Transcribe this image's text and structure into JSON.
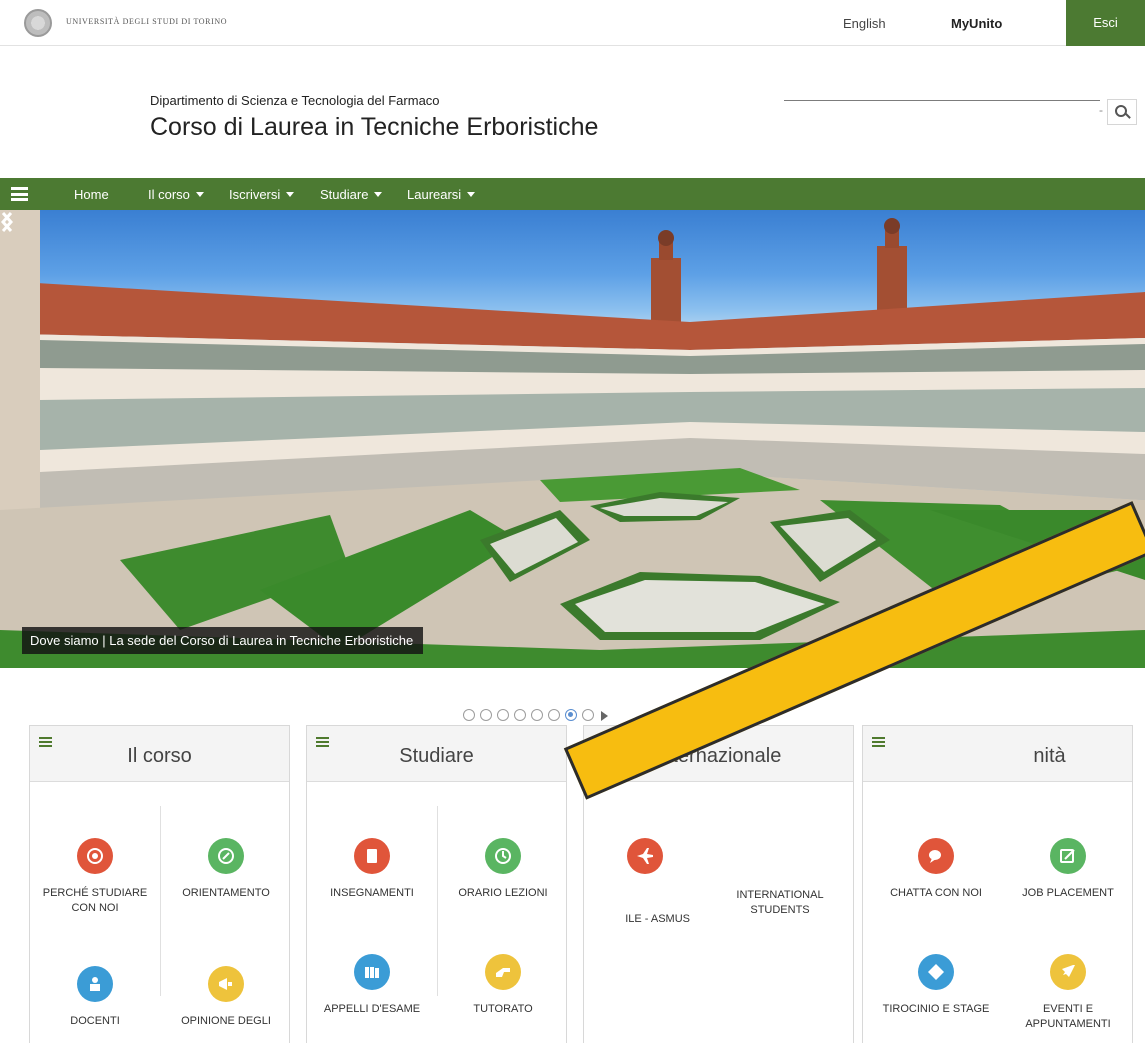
{
  "topbar": {
    "university": "Università degli Studi di Torino",
    "english": "English",
    "myunito": "MyUnito",
    "esci": "Esci"
  },
  "header": {
    "department": "Dipartimento di Scienza e Tecnologia del Farmaco",
    "course_title": "Corso di Laurea in Tecniche Erboristiche",
    "search_separator": "-",
    "search_icon": "search-icon"
  },
  "nav": {
    "items": [
      {
        "label": "Home",
        "dropdown": false
      },
      {
        "label": "Il corso",
        "dropdown": true
      },
      {
        "label": "Iscriversi",
        "dropdown": true
      },
      {
        "label": "Studiare",
        "dropdown": true
      },
      {
        "label": "Laurearsi",
        "dropdown": true
      }
    ]
  },
  "hero": {
    "caption": "Dove siamo | La sede del Corso di Laurea in Tecniche Erboristiche",
    "slides_total": 8,
    "active_slide": 7
  },
  "cards": [
    {
      "title": "Il corso",
      "tiles": [
        {
          "label": "Perché studiare con noi",
          "color": "#e0553a",
          "icon": "target-icon"
        },
        {
          "label": "Orientamento",
          "color": "#5ab562",
          "icon": "compass-icon"
        },
        {
          "label": "Docenti",
          "color": "#3b9cd6",
          "icon": "teacher-icon"
        },
        {
          "label": "Opinione degli",
          "color": "#eec33c",
          "icon": "megaphone-icon"
        }
      ]
    },
    {
      "title": "Studiare",
      "tiles": [
        {
          "label": "Insegnamenti",
          "color": "#e0553a",
          "icon": "book-icon"
        },
        {
          "label": "Orario lezioni",
          "color": "#5ab562",
          "icon": "clock-icon"
        },
        {
          "label": "Appelli d'esame",
          "color": "#3b9cd6",
          "icon": "books-icon"
        },
        {
          "label": "Tutorato",
          "color": "#eec33c",
          "icon": "hand-icon"
        }
      ]
    },
    {
      "title": "Internazionale",
      "tiles": [
        {
          "label": "ile - asmus",
          "color": "#e0553a",
          "icon": "airplane-icon"
        },
        {
          "label": "International students",
          "color": "#5ab562",
          "icon": "globe-icon"
        }
      ]
    },
    {
      "title": "nità",
      "tiles": [
        {
          "label": "Chatta con noi",
          "color": "#e0553a",
          "icon": "chat-icon"
        },
        {
          "label": "Job placement",
          "color": "#5ab562",
          "icon": "pen-icon"
        },
        {
          "label": "Tirocinio e stage",
          "color": "#3b9cd6",
          "icon": "tag-icon"
        },
        {
          "label": "Eventi e appuntamenti",
          "color": "#eec33c",
          "icon": "rocket-icon"
        }
      ]
    }
  ]
}
